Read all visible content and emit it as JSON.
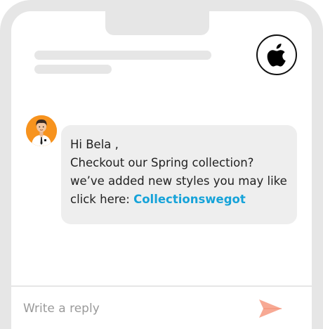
{
  "message": {
    "greeting": "Hi Bela ,",
    "line_2": "Checkout our Spring collection?",
    "line_3": "we’ve added new styles you may like",
    "link_prefix": "click here: ",
    "link_text": "Collectionswegot"
  },
  "composer": {
    "placeholder": "Write a reply"
  },
  "icons": {
    "brand": "apple-icon",
    "send": "send-icon",
    "avatar": "agent-avatar"
  },
  "colors": {
    "link": "#16a3d9",
    "avatar_bg": "#f7931e",
    "send": "#f7a994",
    "bubble": "#eeeeee",
    "frame": "#e6e6e6"
  }
}
